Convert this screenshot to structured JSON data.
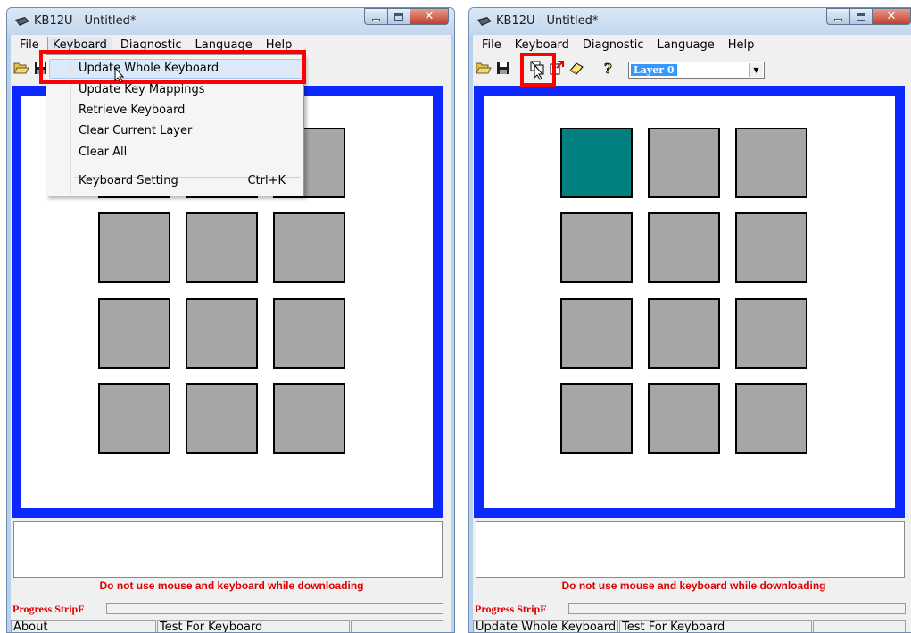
{
  "left_window": {
    "title": "KB12U - Untitled*",
    "menu": [
      "File",
      "Keyboard",
      "Diagnostic",
      "Language",
      "Help"
    ],
    "open_menu": "Keyboard",
    "dropdown": {
      "items": [
        "Update Whole Keyboard",
        "Update Key Mappings",
        "Retrieve Keyboard",
        "Clear Current Layer",
        "Clear All"
      ],
      "setting_label": "Keyboard Setting",
      "setting_shortcut": "Ctrl+K",
      "highlighted": "Update Whole Keyboard"
    },
    "warning": "Do not use mouse and keyboard while downloading",
    "progress_label": "Progress StripF",
    "progress": 0,
    "status": [
      "About",
      "Test For Keyboard",
      ""
    ]
  },
  "right_window": {
    "title": "KB12U - Untitled*",
    "menu": [
      "File",
      "Keyboard",
      "Diagnostic",
      "Language",
      "Help"
    ],
    "toolbar_icons": [
      "open-icon",
      "save-icon",
      "update-keyboard-icon",
      "retrieve-icon",
      "clear-icon",
      "help-icon"
    ],
    "layer_select": "Layer 0",
    "warning": "Do not use mouse and keyboard while downloading",
    "progress_label": "Progress StripF",
    "progress": 0,
    "status": [
      "Update Whole Keyboard",
      "Test For Keyboard",
      ""
    ]
  },
  "keypad": {
    "rows": 4,
    "cols": 3,
    "selected_key": "row 1, column 1"
  },
  "colors": {
    "frame": "#0b29fd",
    "key": "#a6a6a6",
    "selected_key": "#00807f",
    "warning_text": "#e00000",
    "highlight_box": "#ff0000"
  }
}
